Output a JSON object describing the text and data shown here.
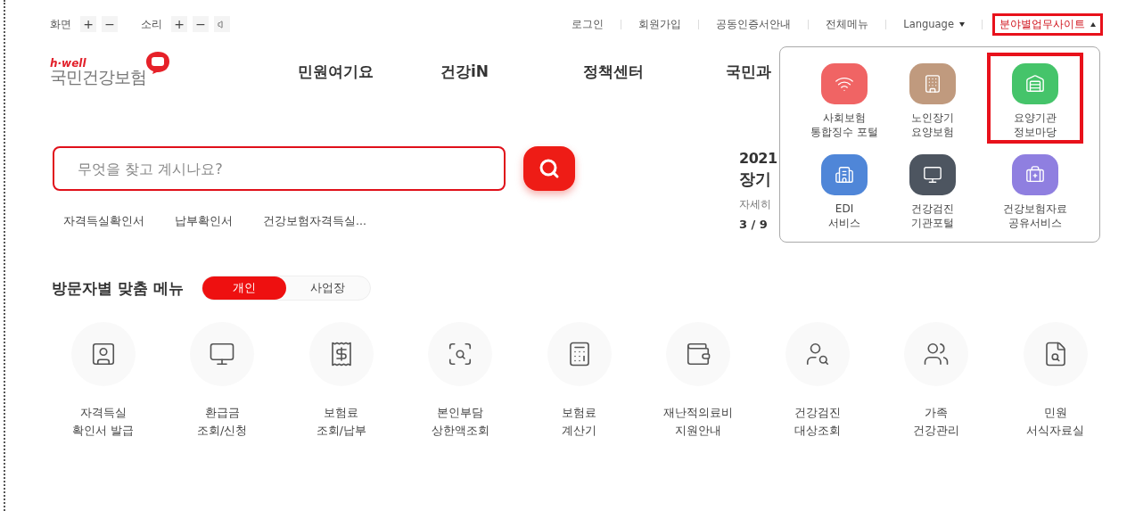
{
  "accessibility": [
    {
      "label": "화면",
      "buttons": [
        "+",
        "−"
      ]
    },
    {
      "label": "소리",
      "buttons": [
        "+",
        "−"
      ]
    }
  ],
  "top_links": [
    {
      "label": "로그인",
      "kind": "link"
    },
    {
      "label": "회원가입",
      "kind": "link"
    },
    {
      "label": "공동인증서안내",
      "kind": "link"
    },
    {
      "label": "전체메뉴",
      "kind": "link"
    },
    {
      "label": "Language",
      "kind": "dropdown",
      "expanded": false,
      "highlighted": false
    },
    {
      "label": "분야별업무사이트",
      "kind": "dropdown",
      "expanded": true,
      "highlighted": true
    }
  ],
  "logo": {
    "tagline": "h·well",
    "name": "국민건강보험"
  },
  "nav": [
    "민원여기요",
    "건강iN",
    "정책센터",
    "국민과"
  ],
  "search": {
    "placeholder": "무엇을 찾고 계시나요?"
  },
  "quick_links": [
    "자격득실확인서",
    "납부확인서",
    "건강보험자격득실..."
  ],
  "banner": {
    "year": "2021",
    "title": "장기",
    "link": "자세히",
    "pager": "3 / 9"
  },
  "site_menu": [
    {
      "lines": [
        "사회보험",
        "통합징수 포털"
      ],
      "color": "#f06464",
      "highlighted": false
    },
    {
      "lines": [
        "노인장기",
        "요양보험"
      ],
      "color": "#c09a7e",
      "highlighted": false
    },
    {
      "lines": [
        "요양기관",
        "정보마당"
      ],
      "color": "#45c46a",
      "highlighted": true
    },
    {
      "lines": [
        "EDI",
        "서비스"
      ],
      "color": "#4f86d8",
      "highlighted": false
    },
    {
      "lines": [
        "건강검진",
        "기관포털"
      ],
      "color": "#4d5560",
      "highlighted": false
    },
    {
      "lines": [
        "건강보험자료",
        "공유서비스"
      ],
      "color": "#8f7fe0",
      "highlighted": false
    }
  ],
  "visitor_menu": {
    "title": "방문자별 맞춤 메뉴",
    "tabs": [
      {
        "label": "개인",
        "selected": true
      },
      {
        "label": "사업장",
        "selected": false
      }
    ],
    "items": [
      {
        "lines": [
          "자격득실",
          "확인서 발급"
        ]
      },
      {
        "lines": [
          "환급금",
          "조회/신청"
        ]
      },
      {
        "lines": [
          "보험료",
          "조회/납부"
        ]
      },
      {
        "lines": [
          "본인부담",
          "상한액조회"
        ]
      },
      {
        "lines": [
          "보험료",
          "계산기"
        ]
      },
      {
        "lines": [
          "재난적의료비",
          "지원안내"
        ]
      },
      {
        "lines": [
          "건강검진",
          "대상조회"
        ]
      },
      {
        "lines": [
          "가족",
          "건강관리"
        ]
      },
      {
        "lines": [
          "민원",
          "서식자료실"
        ]
      }
    ]
  }
}
